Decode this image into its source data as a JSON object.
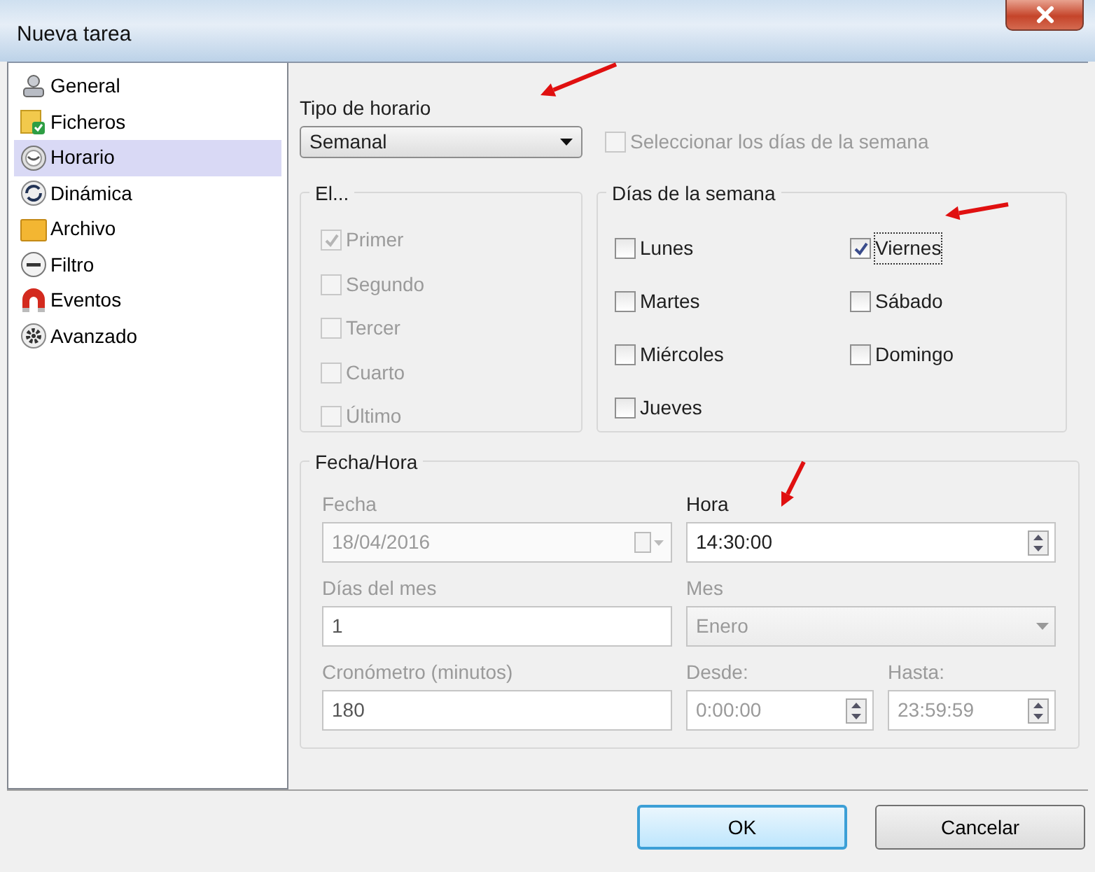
{
  "window": {
    "title": "Nueva tarea"
  },
  "sidebar": {
    "items": [
      {
        "label": "General",
        "selected": false
      },
      {
        "label": "Ficheros",
        "selected": false
      },
      {
        "label": "Horario",
        "selected": true
      },
      {
        "label": "Dinámica",
        "selected": false
      },
      {
        "label": "Archivo",
        "selected": false
      },
      {
        "label": "Filtro",
        "selected": false
      },
      {
        "label": "Eventos",
        "selected": false
      },
      {
        "label": "Avanzado",
        "selected": false
      }
    ]
  },
  "schedule_type": {
    "label": "Tipo de horario",
    "value": "Semanal"
  },
  "select_weekdays": {
    "label": "Seleccionar los días de la semana",
    "checked": false,
    "disabled": true
  },
  "ordinal_group": {
    "title": "El...",
    "disabled": true,
    "options": [
      {
        "label": "Primer",
        "checked": true
      },
      {
        "label": "Segundo",
        "checked": false
      },
      {
        "label": "Tercer",
        "checked": false
      },
      {
        "label": "Cuarto",
        "checked": false
      },
      {
        "label": "Último",
        "checked": false
      }
    ]
  },
  "weekdays_group": {
    "title": "Días de la semana",
    "options": [
      {
        "label": "Lunes",
        "checked": false,
        "focused": false
      },
      {
        "label": "Martes",
        "checked": false,
        "focused": false
      },
      {
        "label": "Miércoles",
        "checked": false,
        "focused": false
      },
      {
        "label": "Jueves",
        "checked": false,
        "focused": false
      },
      {
        "label": "Viernes",
        "checked": true,
        "focused": true
      },
      {
        "label": "Sábado",
        "checked": false,
        "focused": false
      },
      {
        "label": "Domingo",
        "checked": false,
        "focused": false
      }
    ]
  },
  "datetime_group": {
    "title": "Fecha/Hora",
    "fields": [
      {
        "label": "Fecha",
        "value": "18/04/2016",
        "kind": "date",
        "disabled": true
      },
      {
        "label": "Hora",
        "value": "14:30:00",
        "kind": "spin",
        "disabled": false
      },
      {
        "label": "Días del mes",
        "value": "1",
        "kind": "text",
        "disabled": true
      },
      {
        "label": "Mes",
        "value": "Enero",
        "kind": "select",
        "disabled": true
      },
      {
        "label": "Cronómetro (minutos)",
        "value": "180",
        "kind": "text",
        "disabled": true
      },
      {
        "label": "Desde:",
        "value": "0:00:00",
        "kind": "spin",
        "disabled": true
      },
      {
        "label": "Hasta:",
        "value": "23:59:59",
        "kind": "spin",
        "disabled": true
      }
    ]
  },
  "buttons": [
    {
      "label": "OK",
      "default": true
    },
    {
      "label": "Cancelar",
      "default": false
    }
  ],
  "annotations": [
    {
      "kind": "arrow"
    },
    {
      "kind": "arrow"
    },
    {
      "kind": "arrow"
    }
  ]
}
